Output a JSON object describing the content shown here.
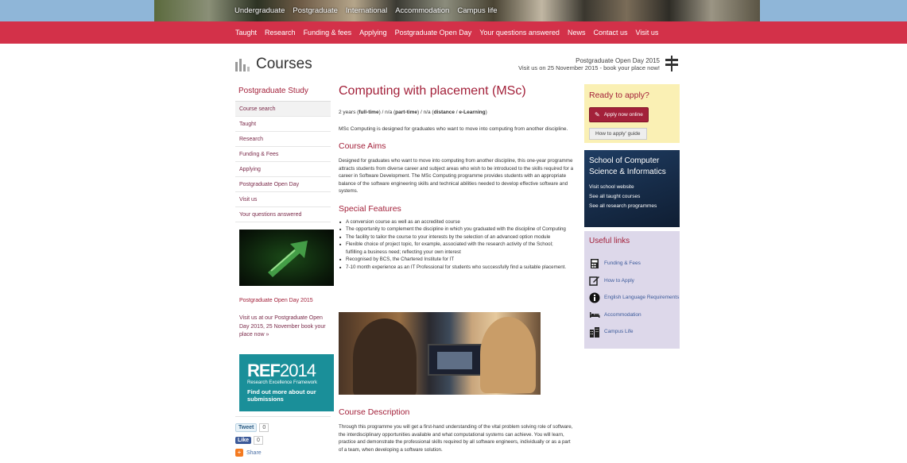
{
  "top_nav": [
    "Undergraduate",
    "Postgraduate",
    "International",
    "Accommodation",
    "Campus life"
  ],
  "red_nav": [
    "Taught",
    "Research",
    "Funding & fees",
    "Applying",
    "Postgraduate Open Day",
    "Your questions answered",
    "News",
    "Contact us",
    "Visit us"
  ],
  "header": {
    "title": "Courses",
    "openday_line1": "Postgraduate Open Day 2015",
    "openday_line2": "Visit us on 25 November 2015 - book your place now!"
  },
  "sidebar": {
    "heading": "Postgraduate Study",
    "items": [
      "Course search",
      "Taught",
      "Research",
      "Funding & Fees",
      "Applying",
      "Postgraduate Open Day",
      "Visit us",
      "Your questions answered"
    ],
    "promo_title": "Postgraduate Open Day 2015",
    "promo_text": "Visit us at our Postgraduate Open Day 2015, 25 November book your place now »",
    "ref": {
      "logo_bold": "REF",
      "logo_thin": "2014",
      "sub": "Research Excellence Framework",
      "link": "Find out more about our submissions"
    },
    "social": {
      "tweet": "Tweet",
      "tweet_count": "0",
      "like": "Like",
      "like_count": "0",
      "share": "Share"
    }
  },
  "main": {
    "title": "Computing with placement (MSc)",
    "duration_a": "2 years (",
    "duration_b": "full-time",
    "duration_c": ") / n/a (",
    "duration_d": "part-time",
    "duration_e": ") / n/a (",
    "duration_f": "distance",
    "duration_g": " / ",
    "duration_h": "e-Learning",
    "duration_i": ")",
    "intro": "MSc Computing is designed for graduates who want to move into computing from another discipline.",
    "aims_title": "Course Aims",
    "aims_text": "Designed for graduates who want to move into computing from another discipline, this one-year programme attracts students from diverse career and subject areas who wish to be introduced to the skills required for a career in Software Development. The MSc Computing programme provides students with an appropriate balance of the software engineering skills and technical abilities needed to develop effective software and systems.",
    "features_title": "Special Features",
    "features": [
      "A conversion course as well as an accredited course",
      "The opportunity to complement the discipline in which you graduated with the discipline of Computing",
      "The facility to tailor the course to your interests by the selection of an advanced option module",
      "Flexible choice of project topic, for example, associated with the research activity of the School; fulfilling a business need; reflecting your own interest",
      "Recognised by BCS, the Chartered Institute for IT",
      "7-10 month experience as an IT Professional for students who successfully find a suitable placement."
    ],
    "description_title": "Course Description",
    "description_text": "Through this programme you will get a first-hand understanding of the vital problem solving role of software, the interdisciplinary opportunities available and what computational systems can achieve. You will learn, practice and demonstrate the professional skills required by all software engineers, individually or as a part of a team, when developing a software solution."
  },
  "right": {
    "apply_title": "Ready to apply?",
    "apply_btn": "Apply now online",
    "guide_btn": "How to apply' guide",
    "school_title": "School of Computer Science & Informatics",
    "school_links": [
      "Visit school website",
      "See all taught courses",
      "See all research programmes"
    ],
    "useful_title": "Useful links",
    "useful_links": [
      "Funding & Fees",
      "How to Apply",
      "English Language Requirements",
      "Accommodation",
      "Campus Life"
    ]
  },
  "colors": {
    "brand_red": "#d33149",
    "heading_red": "#a3213a",
    "apply_bg": "#faf0b4",
    "useful_bg": "#ddd8ea"
  }
}
